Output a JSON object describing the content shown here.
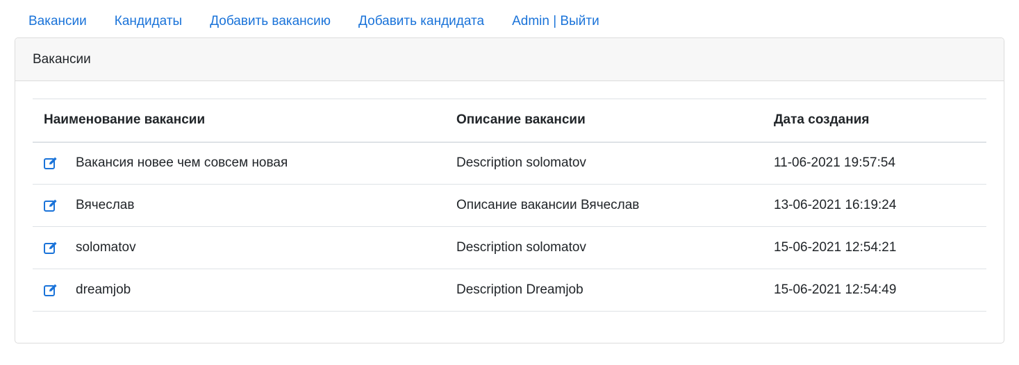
{
  "nav": {
    "items": [
      {
        "label": "Вакансии"
      },
      {
        "label": "Кандидаты"
      },
      {
        "label": "Добавить вакансию"
      },
      {
        "label": "Добавить кандидата"
      },
      {
        "label": "Admin | Выйти"
      }
    ]
  },
  "card": {
    "title": "Вакансии"
  },
  "table": {
    "headers": [
      "Наименование вакансии",
      "Описание вакансии",
      "Дата создания"
    ],
    "rows": [
      {
        "name": "Вакансия новее чем совсем новая",
        "description": "Description solomatov",
        "created": "11-06-2021 19:57:54",
        "icon": "edit-icon"
      },
      {
        "name": "Вячеслав",
        "description": "Описание вакансии Вячеслав",
        "created": "13-06-2021 16:19:24",
        "icon": "edit-icon"
      },
      {
        "name": "solomatov",
        "description": "Description solomatov",
        "created": "15-06-2021 12:54:21",
        "icon": "edit-icon"
      },
      {
        "name": "dreamjob",
        "description": "Description Dreamjob",
        "created": "15-06-2021 12:54:49",
        "icon": "edit-icon"
      }
    ]
  },
  "colors": {
    "link": "#1a73d9",
    "header_bg": "#f7f7f7",
    "border": "#dee2e6"
  }
}
